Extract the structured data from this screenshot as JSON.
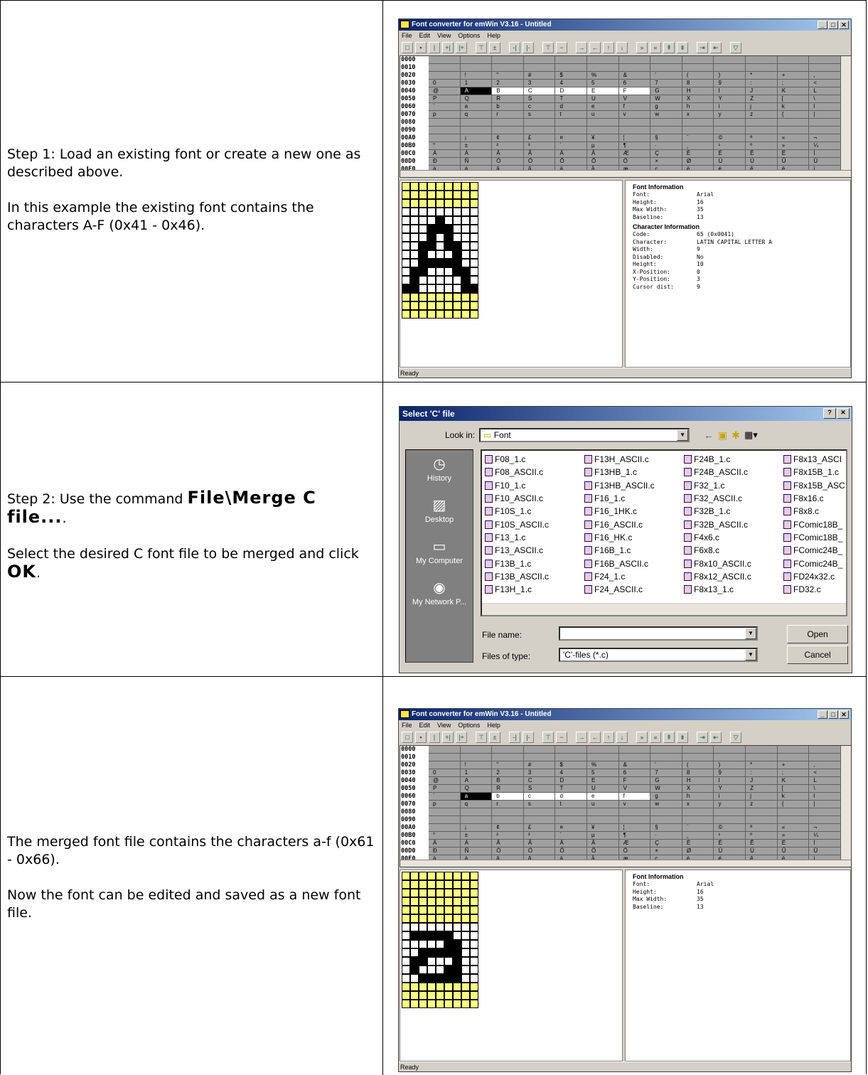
{
  "steps": [
    {
      "p1": "Step 1: Load an existing font or create a new one as described above.",
      "p2": "In this example the existing font contains the characters A-F (0x41 - 0x46)."
    },
    {
      "p1a": "Step 2: Use the command ",
      "p1b": "File\\Merge C file...",
      "p1c": ".",
      "p2a": "Select the desired C font file to be merged and click ",
      "p2b": "OK",
      "p2c": "."
    },
    {
      "p1": "The merged font file contains the characters a-f (0x61 - 0x66).",
      "p2": "Now the font can be edited and saved as a new font file."
    }
  ],
  "app": {
    "title": "Font converter for emWin V3.16 - Untitled",
    "menu": [
      "File",
      "Edit",
      "View",
      "Options",
      "Help"
    ],
    "status": "Ready",
    "codes": [
      "0000",
      "0010",
      "0020",
      "0030",
      "0040",
      "0050",
      "0060",
      "0070",
      "0080",
      "0090",
      "00A0",
      "00B0",
      "00C0",
      "00D0",
      "00E0"
    ],
    "font_info": {
      "title": "Font Information",
      "rows": [
        [
          "Font:",
          "Arial"
        ],
        [
          "Height:",
          "16"
        ],
        [
          "Max Width:",
          "35"
        ],
        [
          "Baseline:",
          "13"
        ]
      ]
    },
    "char_info": {
      "title": "Character Information",
      "rows": [
        [
          "Code:",
          "65 (0x0041)"
        ],
        [
          "Character:",
          "LATIN CAPITAL LETTER A"
        ],
        [
          "Width:",
          "9"
        ],
        [
          "Disabled:",
          "No"
        ],
        [
          "Height:",
          "10"
        ],
        [
          "X-Position:",
          "0"
        ],
        [
          "Y-Position:",
          "3"
        ],
        [
          "Cursor dist:",
          "9"
        ]
      ]
    }
  },
  "dialog": {
    "title": "Select 'C' file",
    "look_in_label": "Look in:",
    "look_in_value": "Font",
    "places": [
      "History",
      "Desktop",
      "My Computer",
      "My Network P..."
    ],
    "files": [
      [
        "F08_1.c",
        "F08_ASCII.c",
        "F10_1.c",
        "F10_ASCII.c",
        "F10S_1.c",
        "F10S_ASCII.c",
        "F13_1.c",
        "F13_ASCII.c",
        "F13B_1.c",
        "F13B_ASCII.c",
        "F13H_1.c"
      ],
      [
        "F13H_ASCII.c",
        "F13HB_1.c",
        "F13HB_ASCII.c",
        "F16_1.c",
        "F16_1HK.c",
        "F16_ASCII.c",
        "F16_HK.c",
        "F16B_1.c",
        "F16B_ASCII.c",
        "F24_1.c",
        "F24_ASCII.c"
      ],
      [
        "F24B_1.c",
        "F24B_ASCII.c",
        "F32_1.c",
        "F32_ASCII.c",
        "F32B_1.c",
        "F32B_ASCII.c",
        "F4x6.c",
        "F6x8.c",
        "F8x10_ASCII.c",
        "F8x12_ASCII.c",
        "F8x13_1.c"
      ],
      [
        "F8x13_ASCI",
        "F8x15B_1.c",
        "F8x15B_ASC",
        "F8x16.c",
        "F8x8.c",
        "FComic18B_",
        "FComic18B_",
        "FComic24B_",
        "FComic24B_",
        "FD24x32.c",
        "FD32.c"
      ]
    ],
    "file_name_label": "File name:",
    "file_name_value": "",
    "file_type_label": "Files of type:",
    "file_type_value": "'C'-files (*.c)",
    "open_label": "Open",
    "cancel_label": "Cancel"
  }
}
